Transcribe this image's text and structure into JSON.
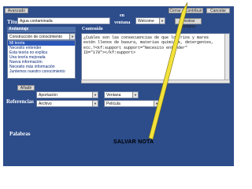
{
  "top": {
    "advanced_label": "Avanzado",
    "save_continue_label": "Cerrar y Contribuir",
    "cancel_label": "Cancelar"
  },
  "title_row": {
    "label": "Título",
    "value": "Agua contaminada",
    "en_label": "en",
    "ventana_label": "ventana",
    "welcome_value": "Welcome",
    "show_label": "Mostrar ventana"
  },
  "left": {
    "header": "Andamiaje",
    "construction_value": "Construcción de conocimiento",
    "items": [
      "Mi teoría",
      "Necesito entender",
      "Esta teoría no explica",
      "Una teoría mejorada",
      "Nueva información",
      "Necesito más información",
      "Juntemos nuestro conocimiento"
    ],
    "selected_index": 0
  },
  "content": {
    "header": "Contenido",
    "lines": [
      "¿Cuáles son las consecuencias de que los ríos y mares",
      "estén llenos de basura, materias químicas, detergentes,",
      "etc.?<kf:support support=\"Necesito entender\"",
      "ID=\"178\"></kf:support>"
    ]
  },
  "add_label": "Añadir",
  "references": {
    "label": "Referencias",
    "aportacion_value": "Aportación",
    "ventana_value": "Ventana",
    "archivo_value": "Archivo",
    "pelicula_value": "Película"
  },
  "keywords": {
    "label": "Palabras"
  },
  "caption": "SALVAR NOTA",
  "colors": {
    "panel": "#2c4c8a",
    "pointer": "#f2e23a",
    "selection": "#2a56b8"
  }
}
